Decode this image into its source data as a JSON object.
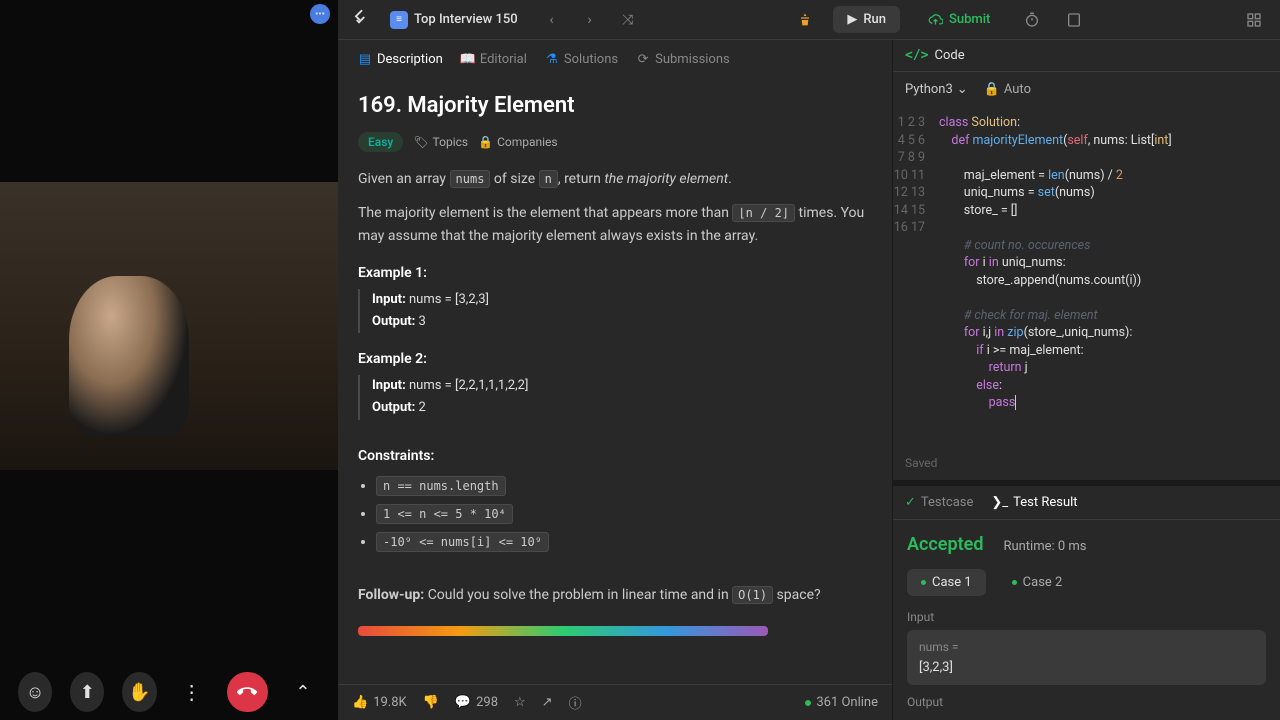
{
  "video": {
    "dots": "•••"
  },
  "call_controls": {
    "emoji": "☺",
    "share": "⬆",
    "hand": "✋",
    "more": "⋮",
    "hangup": "✆",
    "up": "⌃"
  },
  "topbar": {
    "list_name": "Top Interview 150",
    "run": "Run",
    "submit": "Submit"
  },
  "tabs": {
    "description": "Description",
    "editorial": "Editorial",
    "solutions": "Solutions",
    "submissions": "Submissions"
  },
  "problem": {
    "title": "169. Majority Element",
    "difficulty": "Easy",
    "topics_label": "Topics",
    "companies_label": "Companies",
    "desc_pre": "Given an array ",
    "desc_code1": "nums",
    "desc_mid": " of size ",
    "desc_code2": "n",
    "desc_post": ", return ",
    "desc_em": "the majority element",
    "desc_end": ".",
    "desc2_pre": "The majority element is the element that appears more than ",
    "desc2_code": "⌊n / 2⌋",
    "desc2_post": " times. You may assume that the majority element always exists in the array.",
    "ex1_title": "Example 1:",
    "ex1_input_label": "Input:",
    "ex1_input": " nums = [3,2,3]",
    "ex1_output_label": "Output:",
    "ex1_output": " 3",
    "ex2_title": "Example 2:",
    "ex2_input_label": "Input:",
    "ex2_input": " nums = [2,2,1,1,1,2,2]",
    "ex2_output_label": "Output:",
    "ex2_output": " 2",
    "constraints_title": "Constraints:",
    "c1": "n == nums.length",
    "c2": "1 <= n <= 5 * 10⁴",
    "c3": "-10⁹ <= nums[i] <= 10⁹",
    "followup_label": "Follow-up:",
    "followup_pre": " Could you solve the problem in linear time and in ",
    "followup_code": "O(1)",
    "followup_post": " space?"
  },
  "footer": {
    "likes": "19.8K",
    "comments": "298",
    "online": "361 Online"
  },
  "code": {
    "header": "Code",
    "language": "Python3",
    "auto": "Auto",
    "saved": "Saved",
    "line_start": 1,
    "line_end": 17
  },
  "result": {
    "testcase_tab": "Testcase",
    "result_tab": "Test Result",
    "status": "Accepted",
    "runtime_label": "Runtime: 0 ms",
    "case1": "Case 1",
    "case2": "Case 2",
    "input_label": "Input",
    "input_var": "nums =",
    "input_val": "[3,2,3]",
    "output_label": "Output"
  }
}
